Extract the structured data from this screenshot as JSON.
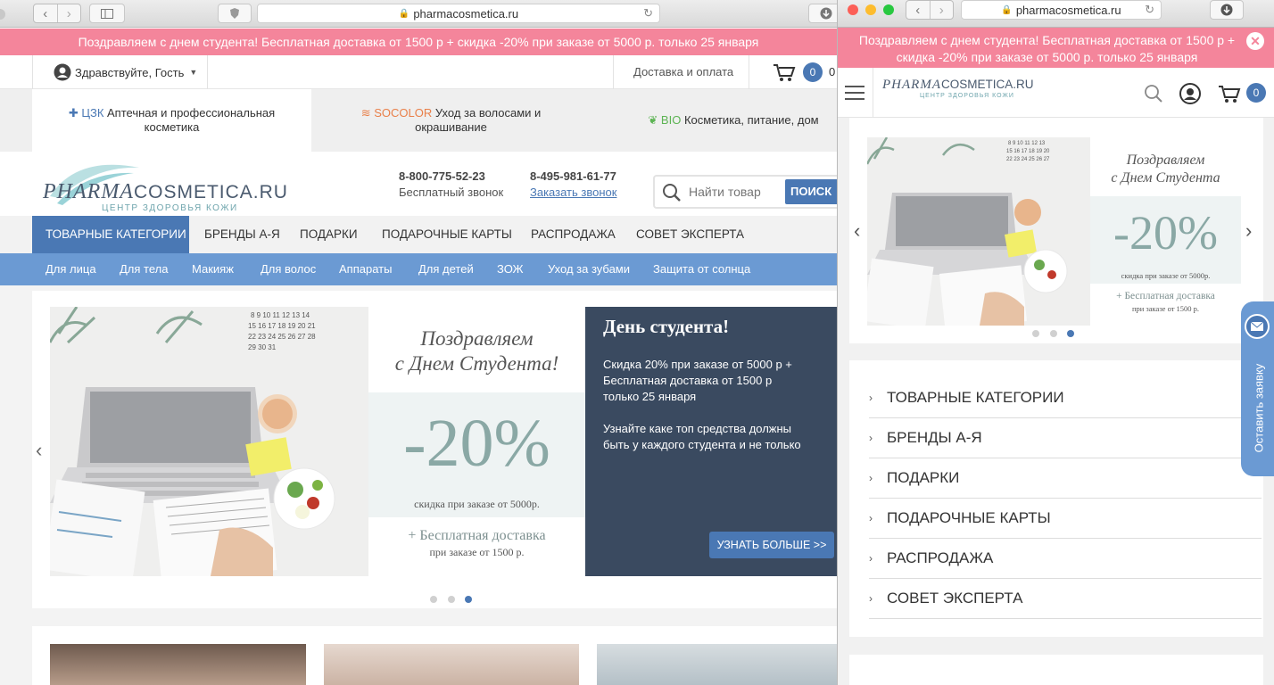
{
  "colors": {
    "accent": "#4a78b4",
    "promo": "#f4859b",
    "hero_panel": "#3a4a60",
    "submenu": "#6b9ad3"
  },
  "left_window": {
    "url": "pharmacosmetica.ru",
    "promo": "Поздравляем с днем студента! Бесплатная доставка от 1500 р + скидка -20% при заказе от 5000 р. только 25 января",
    "greeting": "Здравствуйте, Гость",
    "delivery_link": "Доставка и оплата",
    "cart_count": "0",
    "cart_sum": "0",
    "divisions": [
      {
        "icon": "cross-icon",
        "brand": "ЦЗК",
        "text": "Аптечная и профессиональная косметика"
      },
      {
        "icon": "waves-icon",
        "brand": "SOCOLOR",
        "text": "Уход за волосами и окрашивание"
      },
      {
        "icon": "leaf-icon",
        "brand": "BIO",
        "text": "Косметика, питание, дом"
      }
    ],
    "logo_main": "PHARMA",
    "logo_rest": "COSMETICA.RU",
    "logo_sub": "ЦЕНТР ЗДОРОВЬЯ КОЖИ",
    "phone1": "8-800-775-52-23",
    "phone1_note": "Бесплатный звонок",
    "phone2": "8-495-981-61-77",
    "callback_link": "Заказать звонок",
    "search_placeholder": "Найти товар",
    "search_button": "ПОИСК",
    "main_menu": [
      "ТОВАРНЫЕ КАТЕГОРИИ",
      "БРЕНДЫ А-Я",
      "ПОДАРКИ",
      "ПОДАРОЧНЫЕ КАРТЫ",
      "РАСПРОДАЖА",
      "СОВЕТ ЭКСПЕРТА"
    ],
    "sub_menu": [
      "Для лица",
      "Для тела",
      "Макияж",
      "Для волос",
      "Аппараты",
      "Для детей",
      "ЗОЖ",
      "Уход за зубами",
      "Защита от солнца"
    ],
    "hero": {
      "banner_line1": "Поздравляем",
      "banner_line2": "с Днем Студента!",
      "discount": "-20%",
      "discount_note": "скидка при заказе от 5000р.",
      "delivery": "+ Бесплатная доставка",
      "delivery_note": "при заказе от 1500 р.",
      "panel_title": "День студента!",
      "panel_text1": "Скидка 20% при заказе от 5000 р + Бесплатная доставка от 1500 р только 25 января",
      "panel_text2": "Узнайте каке топ средства должны быть у каждого студента и не только",
      "more_button": "УЗНАТЬ БОЛЬШЕ >>",
      "slides": 3,
      "active_slide": 3
    }
  },
  "right_window": {
    "url": "pharmacosmetica.ru",
    "promo": "Поздравляем с днем студента! Бесплатная доставка от 1500 р + скидка -20% при заказе от 5000 р. только 25 января",
    "logo_main": "PHARMA",
    "logo_rest": "COSMETICA.RU",
    "logo_sub": "ЦЕНТР ЗДОРОВЬЯ КОЖИ",
    "cart_count": "0",
    "hero": {
      "banner_line1": "Поздравляем",
      "banner_line2": "с Днем Студента",
      "discount": "-20%",
      "discount_note": "скидка при заказе от 5000р.",
      "delivery": "+ Бесплатная доставка",
      "delivery_note": "при заказе от 1500 р.",
      "slides": 3,
      "active_slide": 3
    },
    "nav": [
      "ТОВАРНЫЕ КАТЕГОРИИ",
      "БРЕНДЫ А-Я",
      "ПОДАРКИ",
      "ПОДАРОЧНЫЕ КАРТЫ",
      "РАСПРОДАЖА",
      "СОВЕТ ЭКСПЕРТА"
    ],
    "side_tab": "Оставить заявку"
  }
}
